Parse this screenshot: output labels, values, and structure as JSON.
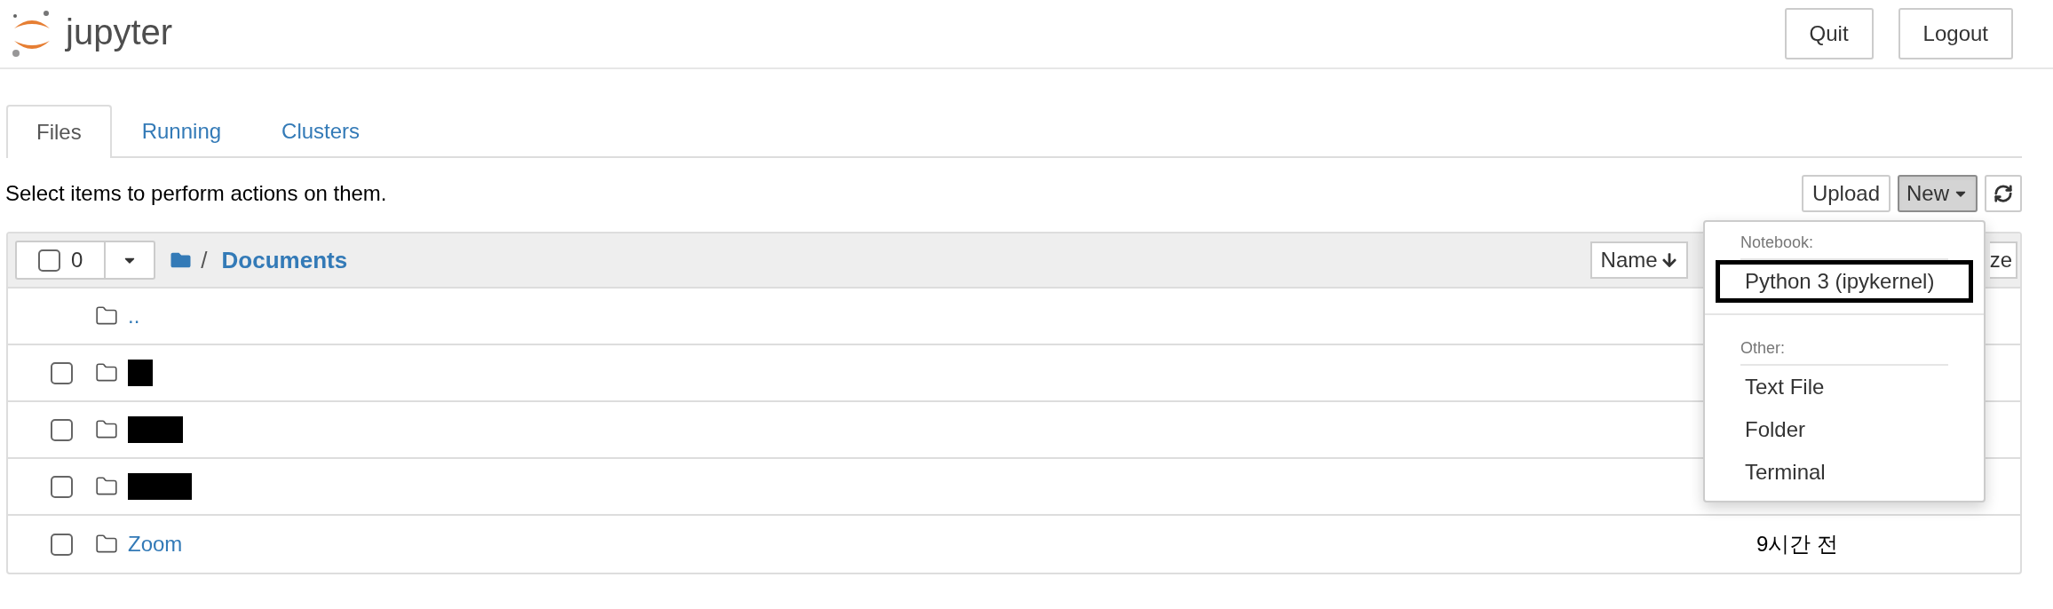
{
  "header": {
    "logo_text": "jupyter",
    "buttons": [
      "Quit",
      "Logout"
    ]
  },
  "tabs": [
    {
      "label": "Files",
      "selected": true
    },
    {
      "label": "Running",
      "selected": false
    },
    {
      "label": "Clusters",
      "selected": false
    }
  ],
  "hint": "Select items to perform actions on them.",
  "toolbar": {
    "upload": "Upload",
    "new": "New",
    "new_pressed": true
  },
  "list_header": {
    "select_all_checked": false,
    "selected_count": "0",
    "path_separator": "/",
    "path": "Documents",
    "sort_buttons": [
      "Name",
      "ze"
    ]
  },
  "rows": [
    {
      "kind": "parent",
      "name": ".."
    },
    {
      "kind": "redacted",
      "checked": false
    },
    {
      "kind": "redacted",
      "checked": false
    },
    {
      "kind": "redacted",
      "checked": false
    },
    {
      "kind": "folder",
      "name": "Zoom",
      "modified": "9시간 전",
      "checked": false
    }
  ],
  "new_menu": [
    {
      "kind": "header",
      "label": "Notebook:"
    },
    {
      "kind": "item",
      "label": "Python 3 (ipykernel)",
      "focused": true
    },
    {
      "kind": "divider"
    },
    {
      "kind": "header",
      "label": "Other:"
    },
    {
      "kind": "item",
      "label": "Text File",
      "focused": false
    },
    {
      "kind": "item",
      "label": "Folder",
      "focused": false
    },
    {
      "kind": "item",
      "label": "Terminal",
      "focused": false
    }
  ]
}
